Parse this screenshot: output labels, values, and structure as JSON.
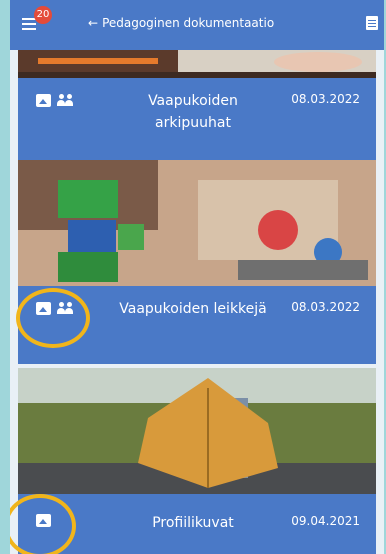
{
  "header": {
    "menu_icon": "menu-icon",
    "notification_count": "20",
    "back_icon": "arrow-left-icon",
    "title": "Pedagoginen dokumentaatio",
    "action_icon": "document-icon"
  },
  "cards": [
    {
      "title": "Vaapukoiden arkipuuhat",
      "date": "08.03.2022",
      "icons": [
        "photo-icon",
        "group-icon"
      ]
    },
    {
      "title": "Vaapukoiden leikkejä",
      "date": "08.03.2022",
      "icons": [
        "photo-icon",
        "group-icon"
      ]
    },
    {
      "title": "Profiilikuvat",
      "date": "09.04.2021",
      "icons": [
        "photo-icon"
      ]
    }
  ],
  "colors": {
    "accent": "#4a79c7",
    "highlight": "#f1b51b",
    "badge": "#e44b3a"
  }
}
